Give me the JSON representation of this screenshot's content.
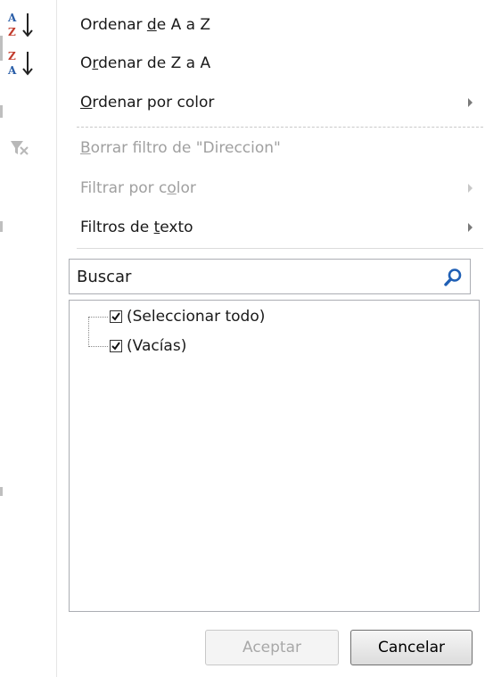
{
  "menu": {
    "sort_az": {
      "prefix": "Ordenar ",
      "underlined": "d",
      "suffix": "e A a Z",
      "icon": "sort-ascending-icon"
    },
    "sort_za": {
      "prefix": "O",
      "underlined": "r",
      "suffix": "denar de Z a A",
      "icon": "sort-descending-icon"
    },
    "sort_color": {
      "prefix": "",
      "underlined": "O",
      "suffix": "rdenar por color",
      "icon": "submenu-arrow-icon"
    },
    "clear_filter": {
      "prefix": "",
      "underlined": "B",
      "suffix": "orrar filtro de \"Direccion\"",
      "icon": "clear-filter-icon",
      "disabled": true
    },
    "filter_color": {
      "prefix": "Filtrar por c",
      "underlined": "o",
      "suffix": "lor",
      "icon": "submenu-arrow-icon",
      "disabled": true
    },
    "text_filters": {
      "prefix": "Filtros de ",
      "underlined": "t",
      "suffix": "exto",
      "icon": "submenu-arrow-icon"
    }
  },
  "search": {
    "placeholder": "Buscar",
    "icon": "search-icon"
  },
  "list": {
    "items": [
      {
        "label": "(Seleccionar todo)",
        "checked": true
      },
      {
        "label": "(Vacías)",
        "checked": true
      }
    ]
  },
  "buttons": {
    "accept": "Aceptar",
    "cancel": "Cancelar"
  },
  "colors": {
    "disabled_text": "#a0a0a0",
    "search_icon": "#1f5fb5"
  }
}
